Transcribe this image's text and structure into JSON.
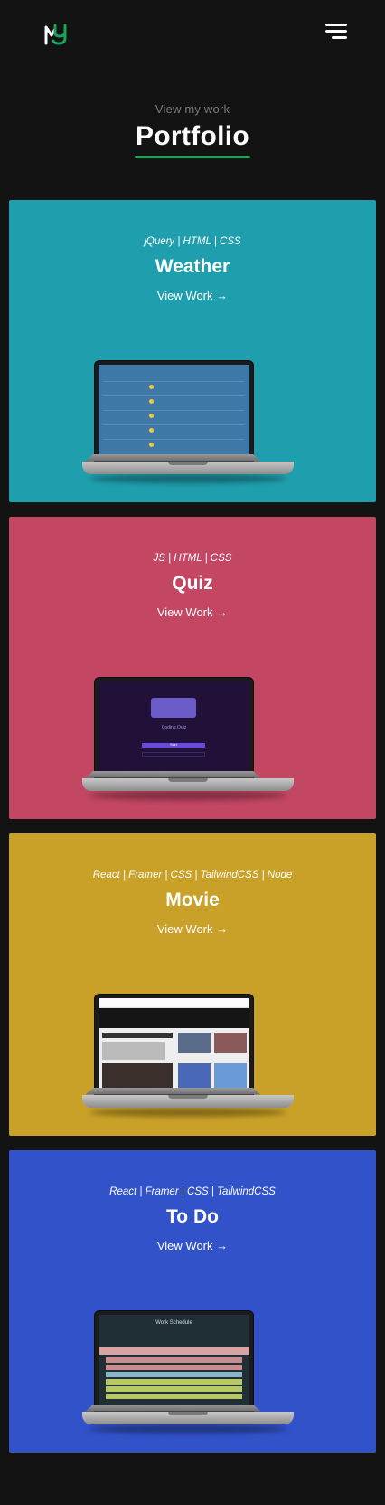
{
  "nav": {
    "logo_text": "MY",
    "menu_icon": "hamburger-menu-icon"
  },
  "intro": {
    "subtitle": "View my work",
    "title": "Portfolio"
  },
  "colors": {
    "background": "#131313",
    "accent": "#17a35a",
    "weather": "#1f9fae",
    "quiz": "#c34663",
    "movie": "#c9a128",
    "todo": "#3152c9"
  },
  "projects": [
    {
      "tech": "jQuery | HTML | CSS",
      "name": "Weather",
      "link": "View Work →",
      "screenshot_icon": "laptop-weather-preview"
    },
    {
      "tech": "JS | HTML | CSS",
      "name": "Quiz",
      "link": "View Work →",
      "screenshot_icon": "laptop-quiz-preview",
      "screen": {
        "title": "Coding Quiz",
        "button": "Start"
      }
    },
    {
      "tech": "React | Framer | CSS | TailwindCSS | Node",
      "name": "Movie",
      "link": "View Work →",
      "screenshot_icon": "laptop-movie-preview"
    },
    {
      "tech": "React | Framer | CSS | TailwindCSS",
      "name": "To Do",
      "link": "View Work →",
      "screenshot_icon": "laptop-todo-preview",
      "screen": {
        "title": "Work Schedule"
      }
    }
  ]
}
